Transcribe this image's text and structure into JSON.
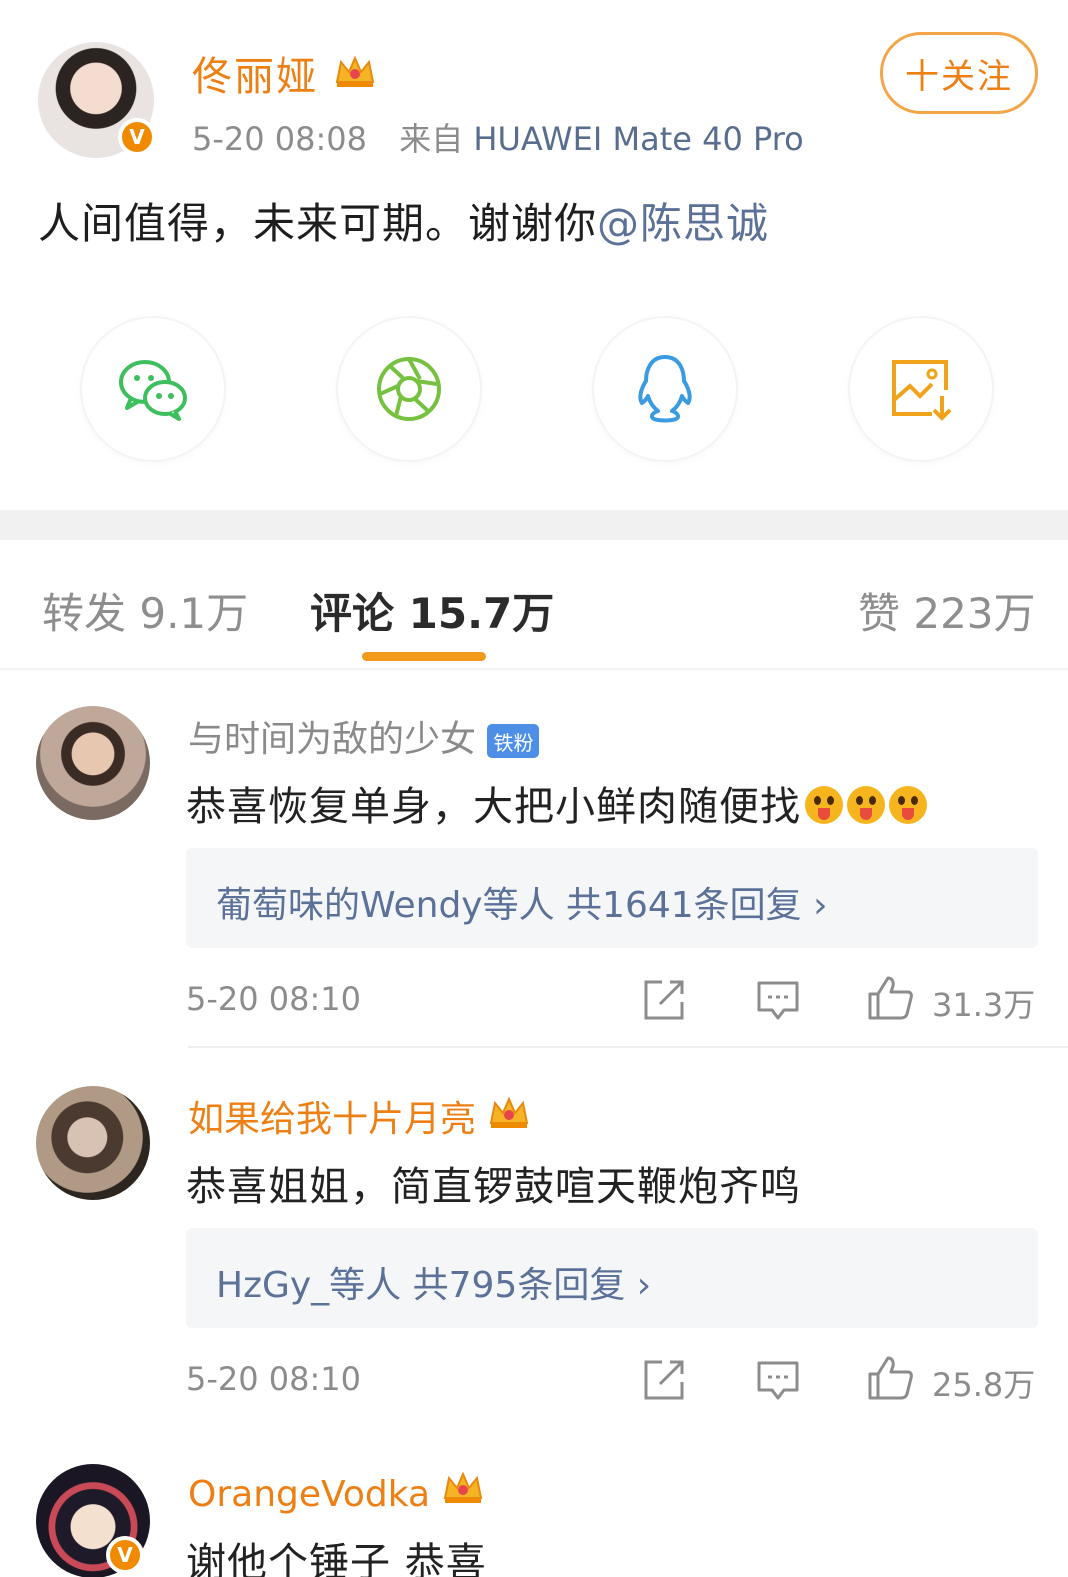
{
  "post": {
    "author": "佟丽娅",
    "time": "5-20 08:08",
    "source_prefix": "来自",
    "device": "HUAWEI Mate 40 Pro",
    "follow_label": "十关注",
    "text_main": "人间值得，未来可期。谢谢你",
    "mention": "@陈思诚"
  },
  "share_icons": [
    "wechat-icon",
    "moments-icon",
    "qq-icon",
    "save-image-icon"
  ],
  "tabs": {
    "repost": "转发 9.1万",
    "comments": "评论 15.7万",
    "likes": "赞 223万"
  },
  "colors": {
    "accent_orange": "#ee7f13",
    "link_blue": "#5b7198",
    "fan_badge_blue": "#4d8fe6",
    "tab_underline": "#f39a1d"
  },
  "comments": [
    {
      "name": "与时间为敌的少女",
      "name_color": "#8a8a8a",
      "badge": "铁粉",
      "text": "恭喜恢复单身，大把小鲜肉随便找",
      "reply_summary": "葡萄味的Wendy等人 共1641条回复 ›",
      "time": "5-20 08:10",
      "likes": "31.3万"
    },
    {
      "name": "如果给我十片月亮",
      "name_color": "#ee7f13",
      "text": "恭喜姐姐，简直锣鼓喧天鞭炮齐鸣",
      "reply_summary": "HzGy_等人 共795条回复 ›",
      "time": "5-20 08:10",
      "likes": "25.8万"
    },
    {
      "name": "OrangeVodka",
      "name_color": "#ee7f13",
      "text": "谢他个锤子 恭喜"
    }
  ]
}
